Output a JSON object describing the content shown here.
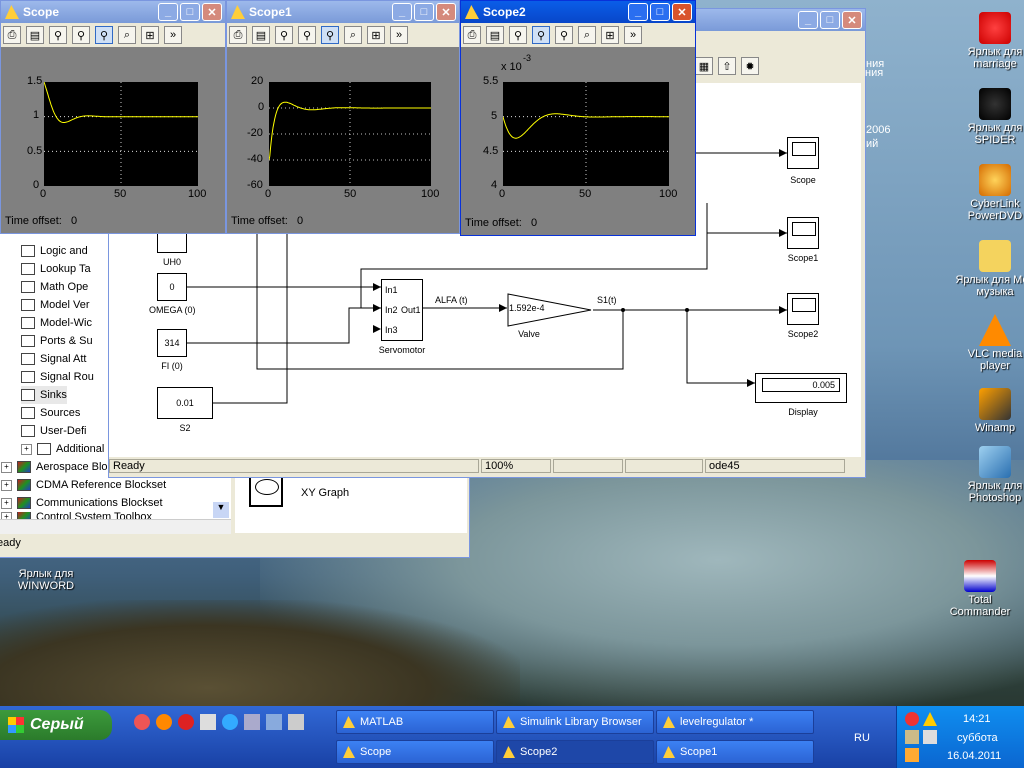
{
  "scope_windows": [
    {
      "title": "Scope",
      "y_ticks": [
        "1.5",
        "1",
        "0.5",
        "0"
      ],
      "x_ticks": [
        "0",
        "50",
        "100"
      ],
      "time_offset_label": "Time offset:",
      "time_offset_value": "0",
      "multiplier": ""
    },
    {
      "title": "Scope1",
      "y_ticks": [
        "20",
        "0",
        "-20",
        "-40",
        "-60"
      ],
      "x_ticks": [
        "0",
        "50",
        "100"
      ],
      "time_offset_label": "Time offset:",
      "time_offset_value": "0",
      "multiplier": ""
    },
    {
      "title": "Scope2",
      "y_ticks": [
        "5.5",
        "5",
        "4.5",
        "4"
      ],
      "x_ticks": [
        "0",
        "50",
        "100"
      ],
      "time_offset_label": "Time offset:",
      "time_offset_value": "0",
      "multiplier": "x 10",
      "multiplier_exp": "-3"
    }
  ],
  "scope_toolbar_icons": [
    "print-icon",
    "params-icon",
    "zoom-icon",
    "zoom-x-icon",
    "zoom-y-icon",
    "autoscale-icon",
    "save-axes-icon",
    "more-icon"
  ],
  "library_browser": {
    "tree": [
      {
        "label": "Logic and",
        "type": "sub"
      },
      {
        "label": "Lookup Ta",
        "type": "sub"
      },
      {
        "label": "Math Ope",
        "type": "sub"
      },
      {
        "label": "Model Ver",
        "type": "sub"
      },
      {
        "label": "Model-Wic",
        "type": "sub"
      },
      {
        "label": "Ports & Su",
        "type": "sub"
      },
      {
        "label": "Signal Att",
        "type": "sub"
      },
      {
        "label": "Signal Rou",
        "type": "sub"
      },
      {
        "label": "Sinks",
        "type": "sub",
        "selected": true
      },
      {
        "label": "Sources",
        "type": "sub"
      },
      {
        "label": "User-Defi",
        "type": "sub"
      },
      {
        "label": "Additional",
        "type": "sub_expand"
      },
      {
        "label": "Aerospace Blo",
        "type": "top"
      },
      {
        "label": "CDMA Reference Blockset",
        "type": "top"
      },
      {
        "label": "Communications Blockset",
        "type": "top"
      },
      {
        "label": "Control System Toolbox",
        "type": "top"
      }
    ],
    "xy_graph_label": "XY Graph",
    "status": "eady"
  },
  "model_window": {
    "title": "levelregulator *",
    "partial_text": [
      "ния",
      "2006",
      "ий"
    ],
    "blocks": {
      "uh0": {
        "value": "",
        "label": "UH0"
      },
      "omega": {
        "value": "0",
        "label": "OMEGA (0)"
      },
      "fi": {
        "value": "314",
        "label": "FI (0)"
      },
      "s2": {
        "value": "0.01",
        "label": "S2"
      },
      "servo": {
        "in1": "In1",
        "in2": "In2",
        "in3": "In3",
        "out1": "Out1",
        "label": "Servomotor"
      },
      "valve": {
        "gain": "1.592e-4",
        "label": "Valve"
      },
      "scope": {
        "label": "Scope"
      },
      "scope1": {
        "label": "Scope1"
      },
      "scope2": {
        "label": "Scope2"
      },
      "display": {
        "value": "0.005",
        "label": "Display"
      }
    },
    "signals": {
      "alfa": "ALFA (t)",
      "s1": "S1(t)"
    },
    "status": {
      "ready": "Ready",
      "zoom": "100%",
      "solver": "ode45"
    }
  },
  "desktop_icons": [
    {
      "label": "Ярлык для marriage",
      "icon": "marriage-icon"
    },
    {
      "label": "Ярлык для SPIDER",
      "icon": "spider-icon"
    },
    {
      "label": "CyberLink PowerDVD",
      "icon": "powerdvd-icon"
    },
    {
      "label": "Ярлык для Моя музыка",
      "icon": "music-folder-icon"
    },
    {
      "label": "VLC media player",
      "icon": "vlc-icon"
    },
    {
      "label": "Winamp",
      "icon": "winamp-icon"
    },
    {
      "label": "Ярлык для Photoshop",
      "icon": "photoshop-icon"
    },
    {
      "label": "Total Commander",
      "icon": "total-commander-icon"
    },
    {
      "label": "Ярлык для WINWORD",
      "icon": "winword-icon"
    }
  ],
  "taskbar": {
    "start": "Серый",
    "tasks_row1": [
      "MATLAB",
      "Simulink Library Browser",
      "levelregulator *"
    ],
    "tasks_row2": [
      "Scope",
      "Scope2",
      "Scope1"
    ],
    "lang": "RU",
    "time": "14:21",
    "day": "суббота",
    "date": "16.04.2011"
  },
  "colors": {
    "titlebar": "#0a5ee8",
    "scope_bg": "#808080",
    "trace": "#ffff00",
    "taskbar": "#245edb",
    "start": "#3c9a3c"
  }
}
